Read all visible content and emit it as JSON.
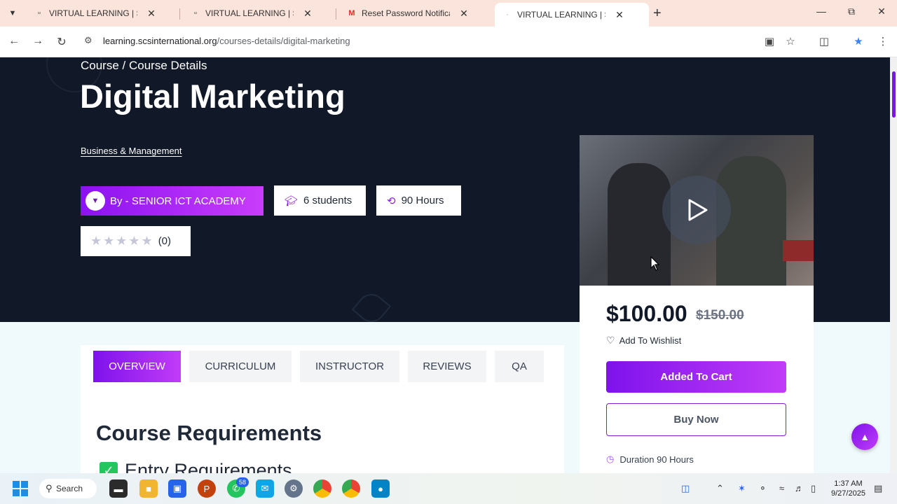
{
  "browser": {
    "tabs": [
      {
        "title": "VIRTUAL LEARNING | SENIOR ICT",
        "favicon": "page-icon",
        "active": false
      },
      {
        "title": "VIRTUAL LEARNING | SENIOR ICT",
        "favicon": "page-icon",
        "active": false
      },
      {
        "title": "Reset Password Notification - m",
        "favicon": "gmail-icon",
        "active": false
      },
      {
        "title": "VIRTUAL LEARNING | SENIOR ICT",
        "favicon": "loading-icon",
        "active": true
      }
    ],
    "url_host": "learning.scsinternational.org",
    "url_path": "/courses-details/digital-marketing"
  },
  "hero": {
    "breadcrumb": "Course / Course Details",
    "title": "Digital Marketing",
    "category": "Business & Management",
    "instructor_label": "By - SENIOR ICT ACADEMY",
    "students": "6 students",
    "hours": "90 Hours",
    "rating_count": "(0)",
    "rating_stars": "★★★★★"
  },
  "pricing": {
    "price": "$100.00",
    "old_price": "$150.00",
    "wishlist": "Add To Wishlist",
    "added_to_cart": "Added To Cart",
    "buy_now": "Buy Now",
    "duration": "Duration 90 Hours"
  },
  "content": {
    "tabs": [
      "OVERVIEW",
      "CURRICULUM",
      "INSTRUCTOR",
      "REVIEWS",
      "QA"
    ],
    "active_tab": "OVERVIEW",
    "section_title": "Course Requirements",
    "first_requirement": "Entry Requirements"
  },
  "taskbar": {
    "search": "Search",
    "whatsapp_badge": "58",
    "time": "1:37 AM",
    "date": "9/27/2025"
  },
  "colors": {
    "accent": "#8b12f0",
    "hero_bg": "#111827"
  }
}
